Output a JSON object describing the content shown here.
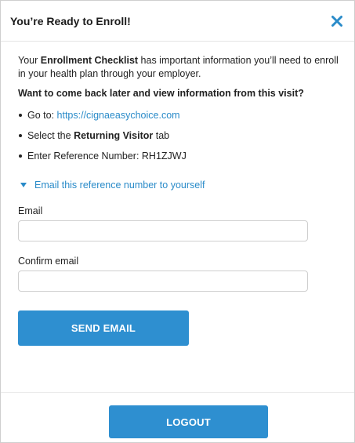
{
  "header": {
    "title": "You’re Ready to Enroll!",
    "close_icon": "close-icon",
    "accent_color": "#2e8fd0"
  },
  "intro": {
    "prefix": "Your ",
    "emphasis": "Enrollment Checklist",
    "suffix": " has important information you’ll need to enroll in your health plan through your employer."
  },
  "question": "Want to come back later and view information from this visit?",
  "steps": {
    "goto_prefix": "Go to: ",
    "goto_link": "https://cignaeasychoice.com",
    "select_prefix": "Select the ",
    "select_emphasis": "Returning Visitor",
    "select_suffix": " tab",
    "reference": "Enter Reference Number: RH1ZJWJ"
  },
  "toggle": {
    "label": "Email this reference number to yourself",
    "icon": "triangle-down-icon"
  },
  "form": {
    "email_label": "Email",
    "email_value": "",
    "confirm_label": "Confirm email",
    "confirm_value": "",
    "send_label": "SEND EMAIL"
  },
  "footer": {
    "logout_label": "LOGOUT"
  }
}
